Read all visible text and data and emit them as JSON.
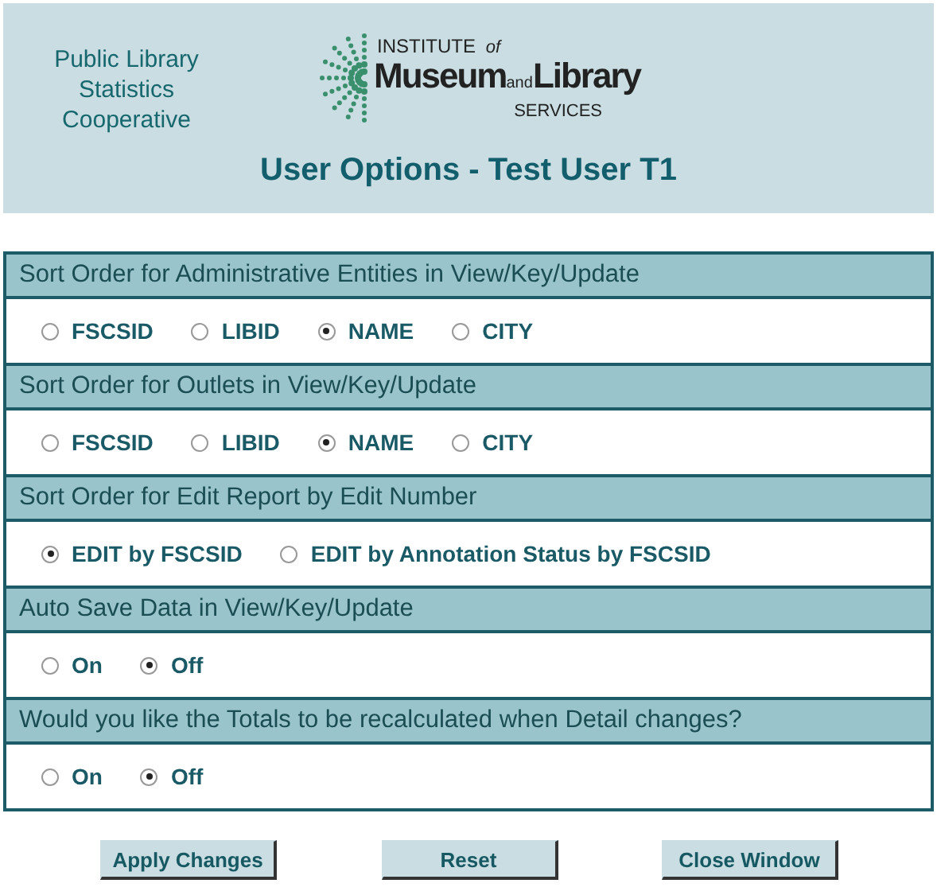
{
  "header": {
    "org_name": [
      "Public Library",
      "Statistics",
      "Cooperative"
    ],
    "logo": {
      "institute": "INSTITUTE",
      "of": "of",
      "museum": "Museum",
      "and": "and",
      "library": "Library",
      "services": "SERVICES"
    },
    "title": "User Options - Test User T1"
  },
  "sections": [
    {
      "heading": "Sort Order for Administrative Entities in View/Key/Update",
      "options": [
        {
          "label": "FSCSID",
          "selected": false
        },
        {
          "label": "LIBID",
          "selected": false
        },
        {
          "label": "NAME",
          "selected": true
        },
        {
          "label": "CITY",
          "selected": false
        }
      ]
    },
    {
      "heading": "Sort Order for Outlets in View/Key/Update",
      "options": [
        {
          "label": "FSCSID",
          "selected": false
        },
        {
          "label": "LIBID",
          "selected": false
        },
        {
          "label": "NAME",
          "selected": true
        },
        {
          "label": "CITY",
          "selected": false
        }
      ]
    },
    {
      "heading": "Sort Order for Edit Report by Edit Number",
      "options": [
        {
          "label": "EDIT by FSCSID",
          "selected": true
        },
        {
          "label": "EDIT by Annotation Status by FSCSID",
          "selected": false
        }
      ]
    },
    {
      "heading": "Auto Save Data in View/Key/Update",
      "options": [
        {
          "label": "On",
          "selected": false
        },
        {
          "label": "Off",
          "selected": true
        }
      ]
    },
    {
      "heading": "Would you like the Totals to be recalculated when Detail changes?",
      "options": [
        {
          "label": "On",
          "selected": false
        },
        {
          "label": "Off",
          "selected": true
        }
      ]
    }
  ],
  "buttons": [
    "Apply Changes",
    "Reset",
    "Close Window"
  ]
}
